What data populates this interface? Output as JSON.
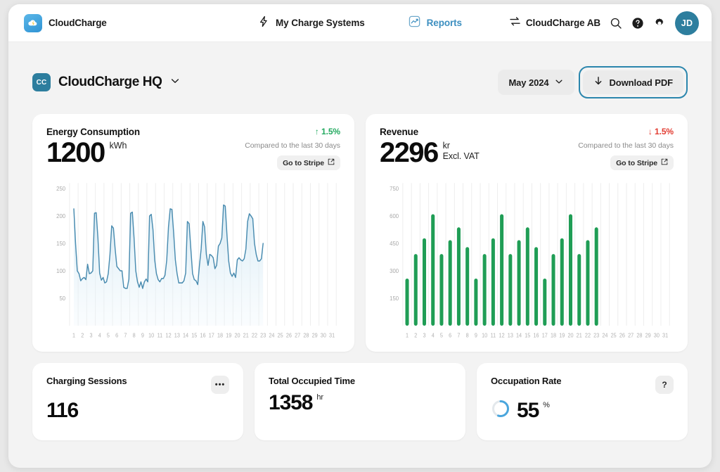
{
  "topbar": {
    "brand": "CloudCharge",
    "nav": [
      {
        "label": "My Charge Systems",
        "icon": "bolt-icon",
        "active": false
      },
      {
        "label": "Reports",
        "icon": "report-chart-icon",
        "active": true
      }
    ],
    "org_name": "CloudCharge AB",
    "org_icon": "switch-arrows-icon",
    "search_icon": "search-icon",
    "help_icon": "help-circle-icon",
    "settings_icon": "gear-icon",
    "avatar_initials": "JD"
  },
  "page_head": {
    "site_badge": "CC",
    "site_title": "CloudCharge HQ",
    "site_chevron": "chevron-down-icon",
    "period_label": "May 2024",
    "period_chevron": "chevron-down-icon",
    "download_label": "Download PDF",
    "download_icon": "download-arrow-icon"
  },
  "energy_card": {
    "title": "Energy Consumption",
    "delta": "1.5%",
    "delta_direction": "up",
    "delta_arrow": "↑",
    "compare": "Compared to the last 30 days",
    "stripe_label": "Go to Stripe",
    "stripe_icon": "external-link-icon",
    "value": "1200",
    "unit": "kWh"
  },
  "revenue_card": {
    "title": "Revenue",
    "delta": "1.5%",
    "delta_direction": "down",
    "delta_arrow": "↓",
    "compare": "Compared to the last 30 days",
    "stripe_label": "Go to Stripe",
    "stripe_icon": "external-link-icon",
    "value": "2296",
    "unit": "kr",
    "unit2": "Excl. VAT"
  },
  "small_cards": [
    {
      "title": "Charging Sessions",
      "value": "116",
      "unit": "",
      "action_icon": "more-options-icon",
      "action_label": "•••"
    },
    {
      "title": "Total Occupied Time",
      "value": "1358",
      "unit": "hr",
      "action_icon": "",
      "action_label": ""
    },
    {
      "title": "Occupation Rate",
      "value": "55",
      "unit": "%",
      "action_icon": "help-icon",
      "action_label": "?",
      "donut_percent": 55
    }
  ],
  "colors": {
    "accent_blue": "#3d8fc0",
    "line_blue": "#4a8cb0",
    "bar_green": "#1f9d55",
    "delta_up": "#22a95f",
    "delta_down": "#e23c31",
    "avatar": "#2d7e9e",
    "focus_ring": "#2b86ad"
  },
  "chart_data": [
    {
      "type": "area",
      "title": "Energy Consumption",
      "xlabel": "",
      "ylabel": "kWh",
      "ylim": [
        0,
        260
      ],
      "yticks": [
        50,
        100,
        150,
        200,
        250
      ],
      "xticks": [
        "1",
        "2",
        "3",
        "4",
        "5",
        "6",
        "7",
        "8",
        "9",
        "10",
        "11",
        "12",
        "13",
        "14",
        "15",
        "16",
        "17",
        "18",
        "19",
        "20",
        "21",
        "22",
        "23",
        "24",
        "25",
        "26",
        "27",
        "28",
        "29",
        "30",
        "31"
      ],
      "grid": true,
      "color": "#4a8cb0",
      "x": [
        1,
        1.2,
        1.4,
        1.6,
        1.8,
        2,
        2.2,
        2.4,
        2.6,
        2.8,
        3,
        3.2,
        3.4,
        3.6,
        3.8,
        4,
        4.2,
        4.4,
        4.6,
        4.8,
        5,
        5.2,
        5.4,
        5.6,
        5.8,
        6,
        6.2,
        6.4,
        6.6,
        6.8,
        7,
        7.2,
        7.4,
        7.6,
        7.8,
        8,
        8.2,
        8.4,
        8.6,
        8.8,
        9,
        9.2,
        9.4,
        9.6,
        9.8,
        10,
        10.2,
        10.4,
        10.6,
        10.8,
        11,
        11.2,
        11.4,
        11.6,
        11.8,
        12,
        12.2,
        12.4,
        12.6,
        12.8,
        13,
        13.2,
        13.4,
        13.6,
        13.8,
        14,
        14.2,
        14.4,
        14.6,
        14.8,
        15,
        15.2,
        15.4,
        15.6,
        15.8,
        16,
        16.2,
        16.4,
        16.6,
        16.8,
        17,
        17.2,
        17.4,
        17.6,
        17.8,
        18,
        18.2,
        18.4,
        18.6,
        18.8,
        19,
        19.2,
        19.4,
        19.6,
        19.8,
        20,
        20.2,
        20.4,
        20.6,
        20.8,
        21,
        21.2,
        21.4,
        21.6,
        21.8,
        22,
        22.2,
        22.4,
        22.6,
        22.8,
        23
      ],
      "values": [
        213,
        150,
        100,
        95,
        82,
        86,
        88,
        84,
        112,
        95,
        96,
        100,
        205,
        206,
        160,
        96,
        83,
        88,
        78,
        80,
        95,
        130,
        182,
        178,
        140,
        108,
        104,
        100,
        100,
        70,
        68,
        68,
        85,
        205,
        207,
        160,
        100,
        80,
        70,
        80,
        68,
        80,
        85,
        80,
        200,
        203,
        175,
        120,
        95,
        84,
        80,
        86,
        86,
        92,
        120,
        180,
        213,
        212,
        170,
        120,
        95,
        78,
        78,
        78,
        82,
        96,
        190,
        186,
        140,
        95,
        84,
        82,
        75,
        110,
        140,
        190,
        180,
        130,
        110,
        130,
        128,
        124,
        104,
        110,
        145,
        150,
        160,
        220,
        218,
        165,
        118,
        96,
        90,
        96,
        88,
        120,
        124,
        120,
        118,
        122,
        140,
        190,
        204,
        200,
        195,
        150,
        130,
        118,
        118,
        122,
        150
      ]
    },
    {
      "type": "bar",
      "title": "Revenue",
      "xlabel": "",
      "ylabel": "kr",
      "ylim": [
        0,
        780
      ],
      "yticks": [
        150,
        300,
        450,
        600,
        750
      ],
      "categories": [
        "1",
        "2",
        "3",
        "4",
        "5",
        "6",
        "7",
        "8",
        "9",
        "10",
        "11",
        "12",
        "13",
        "14",
        "15",
        "16",
        "17",
        "18",
        "19",
        "20",
        "21",
        "22",
        "23",
        "24",
        "25",
        "26",
        "27",
        "28",
        "29",
        "30",
        "31"
      ],
      "grid": true,
      "color": "#1f9d55",
      "values": [
        258,
        392,
        478,
        610,
        392,
        468,
        538,
        430,
        258,
        392,
        478,
        610,
        392,
        468,
        538,
        430,
        258,
        392,
        478,
        610,
        392,
        468,
        538,
        null,
        null,
        null,
        null,
        null,
        null,
        null,
        null
      ]
    }
  ]
}
